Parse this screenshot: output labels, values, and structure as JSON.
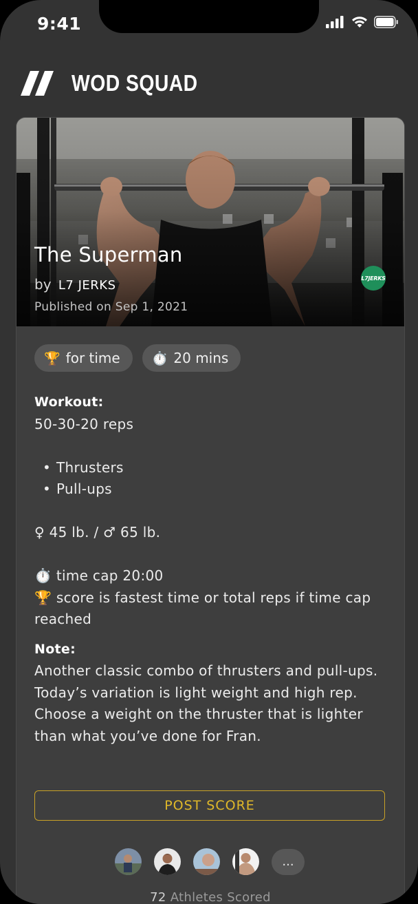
{
  "status_bar": {
    "time": "9:41"
  },
  "app": {
    "title": "WOD SQUAD"
  },
  "workout": {
    "title": "The Superman",
    "by_label": "by",
    "author": "L7 JERKS",
    "team_logo_text": "L7JERKS",
    "published": "Published on Sep 1, 2021",
    "tags": [
      {
        "emoji": "🏆",
        "label": "for time"
      },
      {
        "emoji": "⏱️",
        "label": "20 mins"
      }
    ],
    "workout_heading": "Workout:",
    "reps": "50-30-20 reps",
    "movements": [
      "Thrusters",
      "Pull-ups"
    ],
    "weights": "♀ 45 lb. / ♂ 65 lb.",
    "time_cap": "⏱️ time cap 20:00",
    "scoring": "🏆 score is fastest time or total reps if time cap reached",
    "note_heading": "Note:",
    "note": "Another classic combo of thrusters and pull-ups. Today’s variation is light weight and high rep. Choose a weight on the thruster that is lighter than what you’ve done for Fran."
  },
  "actions": {
    "post_score": "POST SCORE",
    "more": "..."
  },
  "athletes": {
    "count": "72",
    "label": "Athletes Scored"
  },
  "colors": {
    "accent": "#e0b829",
    "background": "#333333",
    "card": "#3e3e3e"
  }
}
